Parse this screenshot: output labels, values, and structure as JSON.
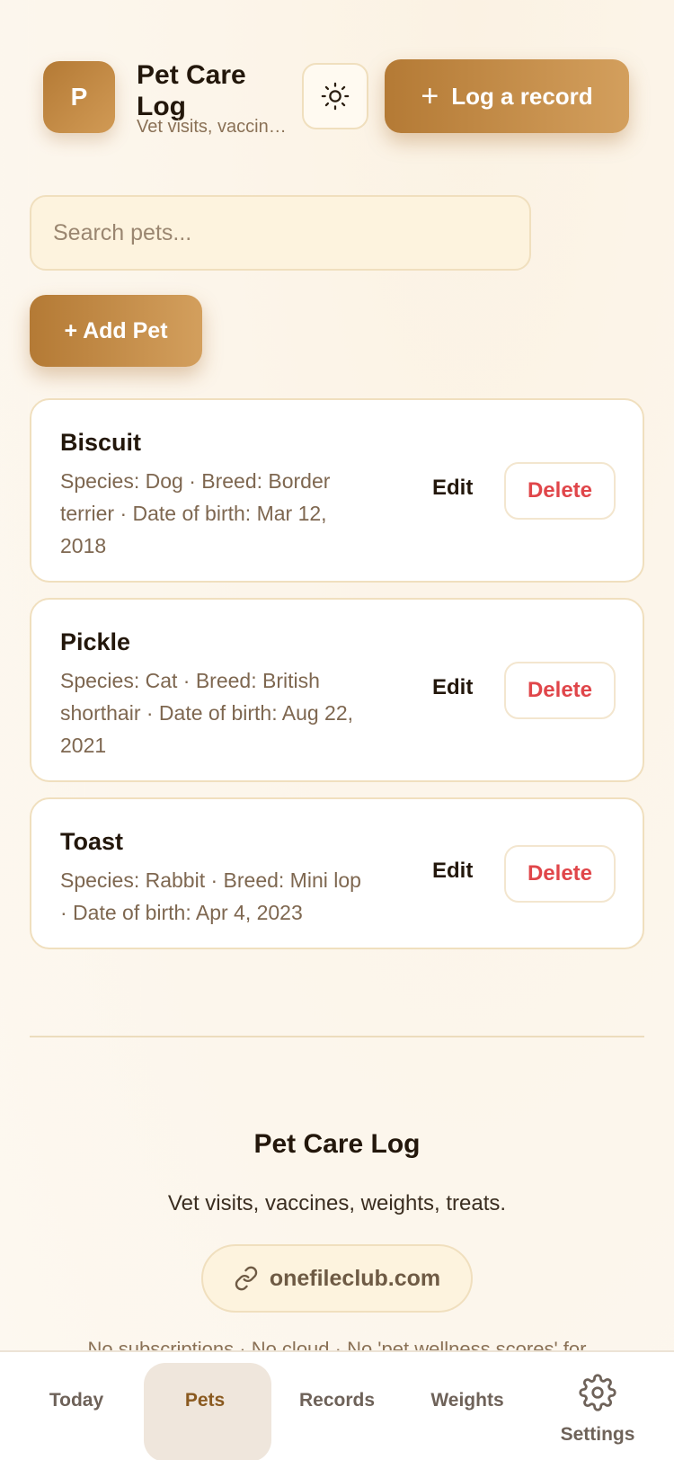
{
  "header": {
    "logo_letter": "P",
    "title": "Pet Care Log",
    "subtitle": "Vet visits, vaccines, weights, treats.",
    "theme_icon": "sun-icon",
    "log_button_label": "Log a record"
  },
  "search": {
    "placeholder": "Search pets...",
    "value": ""
  },
  "add_pet_label": "+ Add Pet",
  "pets": [
    {
      "name": "Biscuit",
      "meta": "Species: Dog · Breed: Border terrier · Date of birth: Mar 12, 2018",
      "edit": "Edit",
      "delete": "Delete"
    },
    {
      "name": "Pickle",
      "meta": "Species: Cat · Breed: British shorthair · Date of birth: Aug 22, 2021",
      "edit": "Edit",
      "delete": "Delete"
    },
    {
      "name": "Toast",
      "meta": "Species: Rabbit · Breed: Mini lop · Date of birth: Apr 4, 2023",
      "edit": "Edit",
      "delete": "Delete"
    }
  ],
  "footer": {
    "title": "Pet Care Log",
    "tagline": "Vet visits, vaccines, weights, treats.",
    "link": "onefileclub.com",
    "note": "No subscriptions · No cloud · No 'pet wellness scores' for"
  },
  "nav": {
    "items": [
      {
        "label": "Today"
      },
      {
        "label": "Pets"
      },
      {
        "label": "Records"
      },
      {
        "label": "Weights"
      },
      {
        "label": "Settings",
        "icon": "gear-icon"
      }
    ],
    "active": "Pets"
  },
  "colors": {
    "accent": "#b47a35",
    "danger": "#e0464a",
    "border": "#f0dfbe"
  }
}
